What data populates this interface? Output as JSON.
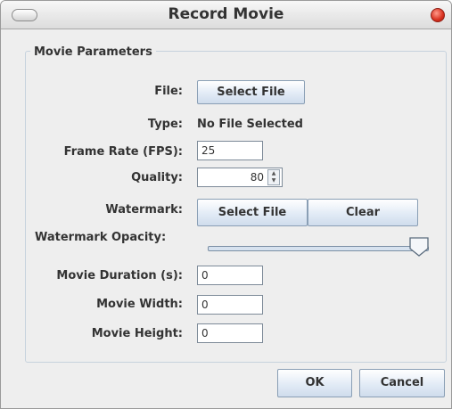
{
  "window": {
    "title": "Record Movie"
  },
  "group": {
    "title": "Movie Parameters"
  },
  "file": {
    "label": "File:",
    "button": "Select File"
  },
  "type": {
    "label": "Type:",
    "value": "No File Selected"
  },
  "frame_rate": {
    "label": "Frame Rate (FPS):",
    "value": "25"
  },
  "quality": {
    "label": "Quality:",
    "value": "80"
  },
  "watermark": {
    "label": "Watermark:",
    "select_button": "Select File",
    "clear_button": "Clear"
  },
  "opacity": {
    "label": "Watermark Opacity:",
    "value_fraction": 1.0
  },
  "duration": {
    "label": "Movie Duration (s):",
    "value": "0"
  },
  "width": {
    "label": "Movie Width:",
    "value": "0"
  },
  "height": {
    "label": "Movie Height:",
    "value": "0"
  },
  "actions": {
    "ok": "OK",
    "cancel": "Cancel"
  },
  "colors": {
    "close_button": "#d8301e",
    "group_border": "#c6d2dd",
    "button_border": "#8a9fb5"
  }
}
